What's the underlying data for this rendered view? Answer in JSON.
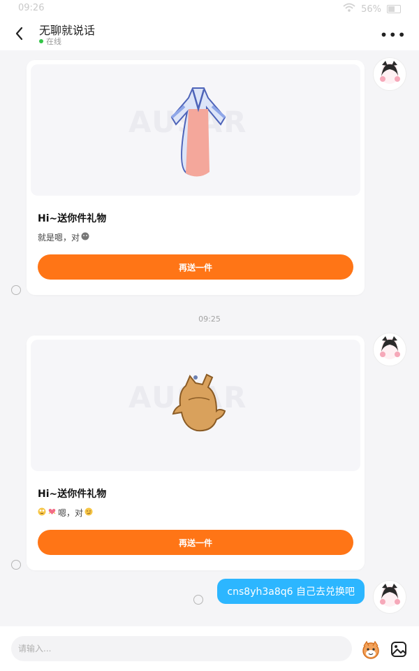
{
  "status_bar": {
    "time": "09:26",
    "battery": "56%"
  },
  "header": {
    "title": "无聊就说话",
    "status": "在线"
  },
  "messages": [
    {
      "type": "gift_card",
      "gift_title": "Hi~送你件礼物",
      "description": "就是嗯，对",
      "button_label": "再送一件",
      "gift_icon": "robe-icon"
    },
    {
      "type": "timestamp",
      "text": "09:25"
    },
    {
      "type": "gift_card",
      "gift_title": "Hi~送你件礼物",
      "description": "嗯，对",
      "button_label": "再送一件",
      "gift_icon": "teapot-icon"
    },
    {
      "type": "text",
      "text": "cns8yh3a8q6 自己去兑换吧"
    }
  ],
  "composer": {
    "placeholder": "请输入..."
  },
  "colors": {
    "accent": "#ff7516",
    "bubble": "#2cb6ff",
    "online": "#33c447"
  }
}
